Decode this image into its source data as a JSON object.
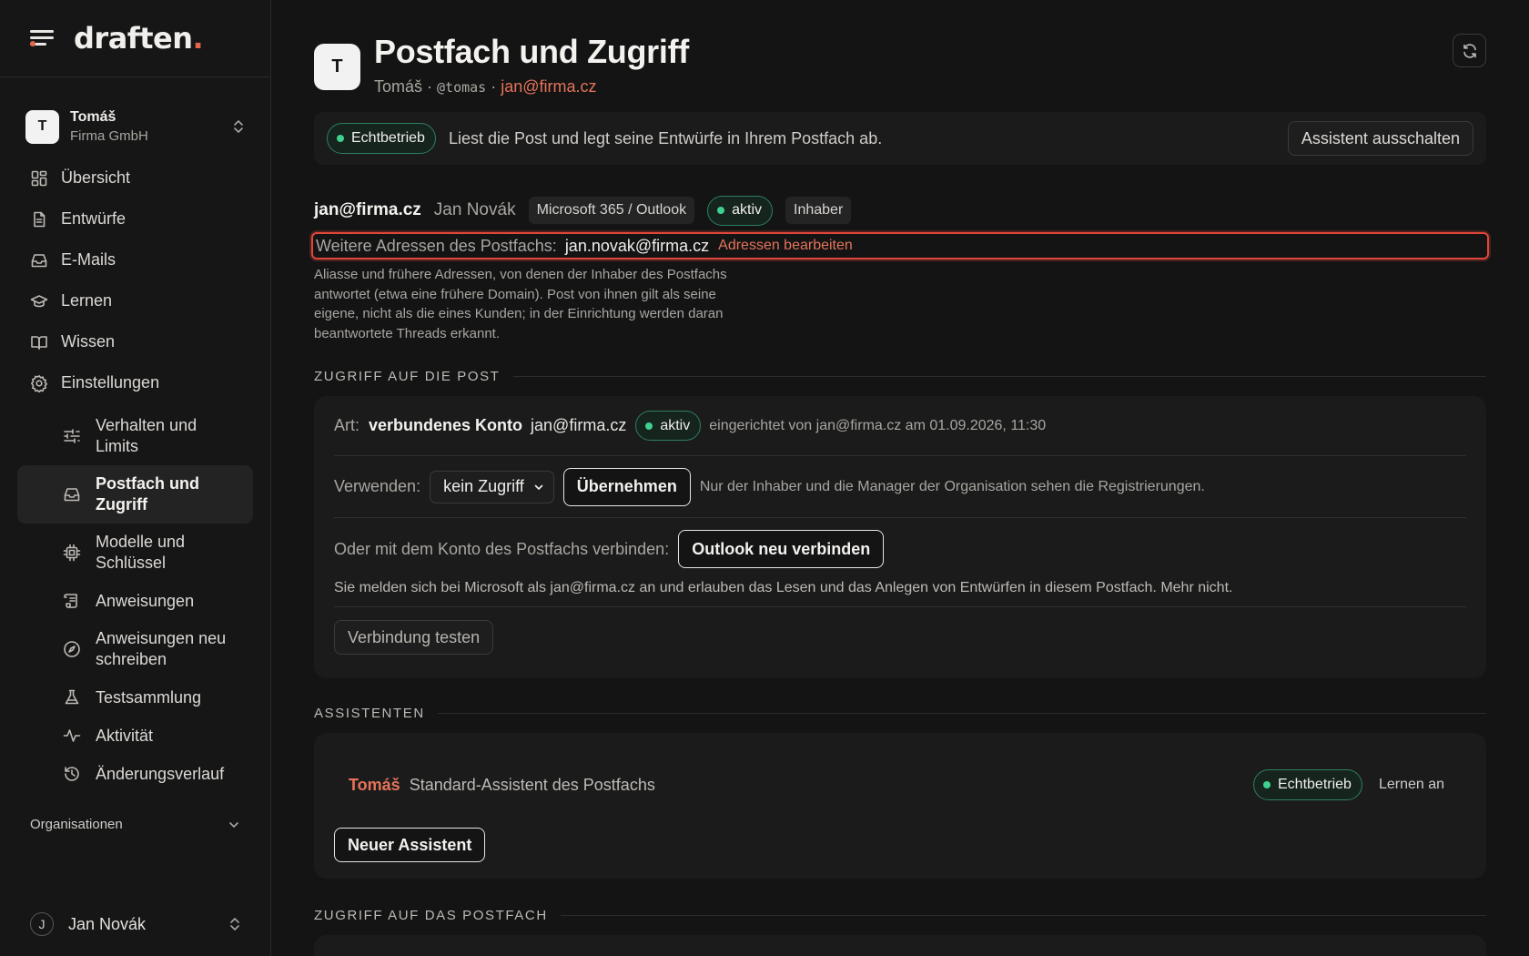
{
  "app": {
    "logo_text": "draften",
    "logo_dot": "."
  },
  "sidebar": {
    "workspace": {
      "avatar": "T",
      "name": "Tomáš",
      "org": "Firma GmbH"
    },
    "nav": [
      {
        "label": "Übersicht",
        "icon": "grid-icon"
      },
      {
        "label": "Entwürfe",
        "icon": "document-icon"
      },
      {
        "label": "E-Mails",
        "icon": "inbox-icon"
      },
      {
        "label": "Lernen",
        "icon": "graduation-cap-icon"
      },
      {
        "label": "Wissen",
        "icon": "book-icon"
      },
      {
        "label": "Einstellungen",
        "icon": "gear-icon"
      }
    ],
    "settings_sub": [
      {
        "label": "Verhalten und Limits",
        "icon": "sliders-icon"
      },
      {
        "label": "Postfach und Zugriff",
        "icon": "inbox-icon",
        "active": true
      },
      {
        "label": "Modelle und Schlüssel",
        "icon": "chip-icon"
      },
      {
        "label": "Anweisungen",
        "icon": "scroll-icon"
      },
      {
        "label": "Anweisungen neu schreiben",
        "icon": "compass-icon"
      },
      {
        "label": "Testsammlung",
        "icon": "flask-icon"
      },
      {
        "label": "Aktivität",
        "icon": "activity-icon"
      },
      {
        "label": "Änderungsverlauf",
        "icon": "history-icon"
      }
    ],
    "organisations_label": "Organisationen",
    "user": {
      "initial": "J",
      "name": "Jan Novák"
    }
  },
  "header": {
    "avatar": "T",
    "title": "Postfach und Zugriff",
    "sub_name": "Tomáš",
    "sub_sep": " · ",
    "sub_handle": "@tomas",
    "sub_email": "jan@firma.cz"
  },
  "banner": {
    "status": "Echtbetrieb",
    "text": "Liest die Post und legt seine Entwürfe in Ihrem Postfach ab.",
    "button": "Assistent ausschalten"
  },
  "mailbox": {
    "email": "jan@firma.cz",
    "owner_name": "Jan Novák",
    "provider": "Microsoft 365 / Outlook",
    "status": "aktiv",
    "role": "Inhaber",
    "addresses_label": "Weitere Adressen des Postfachs:",
    "addresses_value": "jan.novak@firma.cz",
    "addresses_link": "Adressen bearbeiten",
    "addresses_help": "Aliasse und frühere Adressen, von denen der Inhaber des Postfachs antwortet (etwa eine frühere Domain). Post von ihnen gilt als seine eigene, nicht als die eines Kunden; in der Einrichtung werden daran beantwortete Threads erkannt."
  },
  "access": {
    "section_title": "ZUGRIFF AUF DIE POST",
    "type_label": "Art:",
    "type_value": "verbundenes Konto",
    "type_email": "jan@firma.cz",
    "type_status": "aktiv",
    "setup_info": "eingerichtet von jan@firma.cz am 01.09.2026, 11:30",
    "use_label": "Verwenden:",
    "use_select": "kein Zugriff",
    "apply_button": "Übernehmen",
    "use_note": "Nur der Inhaber und die Manager der Organisation sehen die Registrierungen.",
    "connect_label": "Oder mit dem Konto des Postfachs verbinden:",
    "connect_button": "Outlook neu verbinden",
    "connect_note": "Sie melden sich bei Microsoft als jan@firma.cz an und erlauben das Lesen und das Anlegen von Entwürfen in diesem Postfach. Mehr nicht.",
    "test_button": "Verbindung testen"
  },
  "assistants": {
    "section_title": "ASSISTENTEN",
    "items": [
      {
        "name": "Tomáš",
        "description": "Standard-Assistent des Postfachs",
        "status": "Echtbetrieb",
        "action": "Lernen an"
      }
    ],
    "new_button": "Neuer Assistent"
  },
  "mailbox_access": {
    "section_title": "ZUGRIFF AUF DAS POSTFACH"
  },
  "colors": {
    "accent": "#e4735a",
    "status_green": "#3fcf8e",
    "highlight_border": "#e0463a"
  }
}
